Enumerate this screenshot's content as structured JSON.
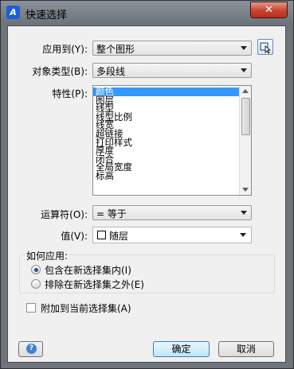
{
  "window": {
    "title": "快速选择",
    "close_glyph": "✕",
    "app_icon_glyph": "A"
  },
  "apply_to": {
    "label": "应用到(Y):",
    "value": "整个图形"
  },
  "object_type": {
    "label": "对象类型(B):",
    "value": "多段线"
  },
  "properties": {
    "label": "特性(P):",
    "items": [
      "颜色",
      "图层",
      "线型",
      "线型比例",
      "线宽",
      "超链接",
      "打印样式",
      "厚度",
      "闭合",
      "全局宽度",
      "标高"
    ],
    "selected_index": 0
  },
  "operator": {
    "label": "运算符(O):",
    "value": "= 等于"
  },
  "value": {
    "label": "值(V):",
    "value": "随层"
  },
  "how_to_apply": {
    "title": "如何应用:",
    "include_label": "包含在新选择集内(I)",
    "exclude_label": "排除在新选择集之外(E)",
    "selected": "include"
  },
  "append": {
    "label": "附加到当前选择集(A)",
    "checked": false
  },
  "buttons": {
    "help_glyph": "?",
    "ok": "确定",
    "cancel": "取消"
  },
  "colors": {
    "selection": "#3399ff",
    "title_bar": "#6f747b",
    "close": "#c9432e"
  }
}
